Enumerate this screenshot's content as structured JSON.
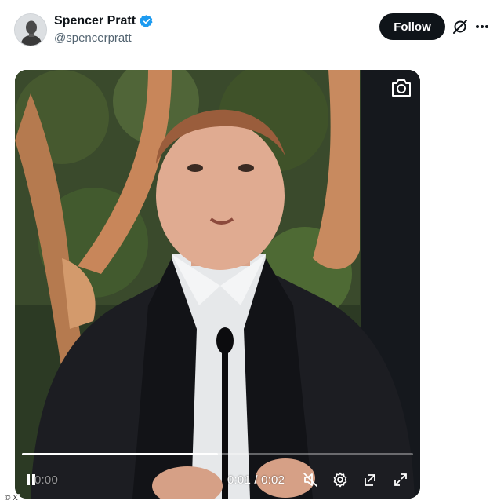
{
  "author": {
    "display_name": "Spencer Pratt",
    "handle": "@spencerpratt",
    "verified": true
  },
  "actions": {
    "follow_label": "Follow",
    "grok_icon": "grok-icon",
    "more_icon": "more-dots-icon"
  },
  "video": {
    "current_time": "0:01",
    "separator": "/",
    "duration": "0:02",
    "faint_time": "0:00",
    "progress_fraction": 0.5,
    "controls_icons": [
      "play-pause-icon",
      "mute-icon",
      "settings-icon",
      "popout-icon",
      "fullscreen-icon"
    ],
    "overlay_icon": "camera-icon"
  },
  "watermark": "© X",
  "colors": {
    "follow_bg": "#0f1419",
    "verified_blue": "#1d9bf0",
    "handle_gray": "#536471"
  }
}
